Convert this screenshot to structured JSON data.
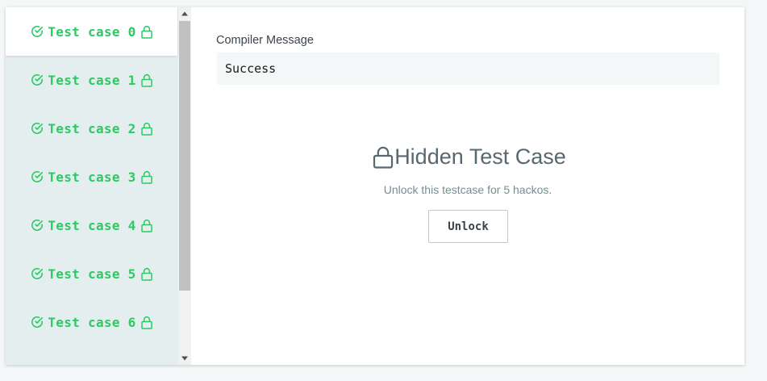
{
  "sidebar": {
    "test_cases": [
      {
        "label": "Test case 0",
        "active": true
      },
      {
        "label": "Test case 1",
        "active": false
      },
      {
        "label": "Test case 2",
        "active": false
      },
      {
        "label": "Test case 3",
        "active": false
      },
      {
        "label": "Test case 4",
        "active": false
      },
      {
        "label": "Test case 5",
        "active": false
      },
      {
        "label": "Test case 6",
        "active": false
      }
    ]
  },
  "compiler": {
    "label": "Compiler Message",
    "message": "Success"
  },
  "hidden": {
    "title": "Hidden Test Case",
    "description": "Unlock this testcase for 5 hackos.",
    "unlock_label": "Unlock"
  },
  "colors": {
    "success_green": "#2ec866",
    "sidebar_bg": "#e5eeee",
    "title_gray": "#576871"
  },
  "icons": {
    "status": "check-circle-icon",
    "locked": "lock-icon"
  }
}
